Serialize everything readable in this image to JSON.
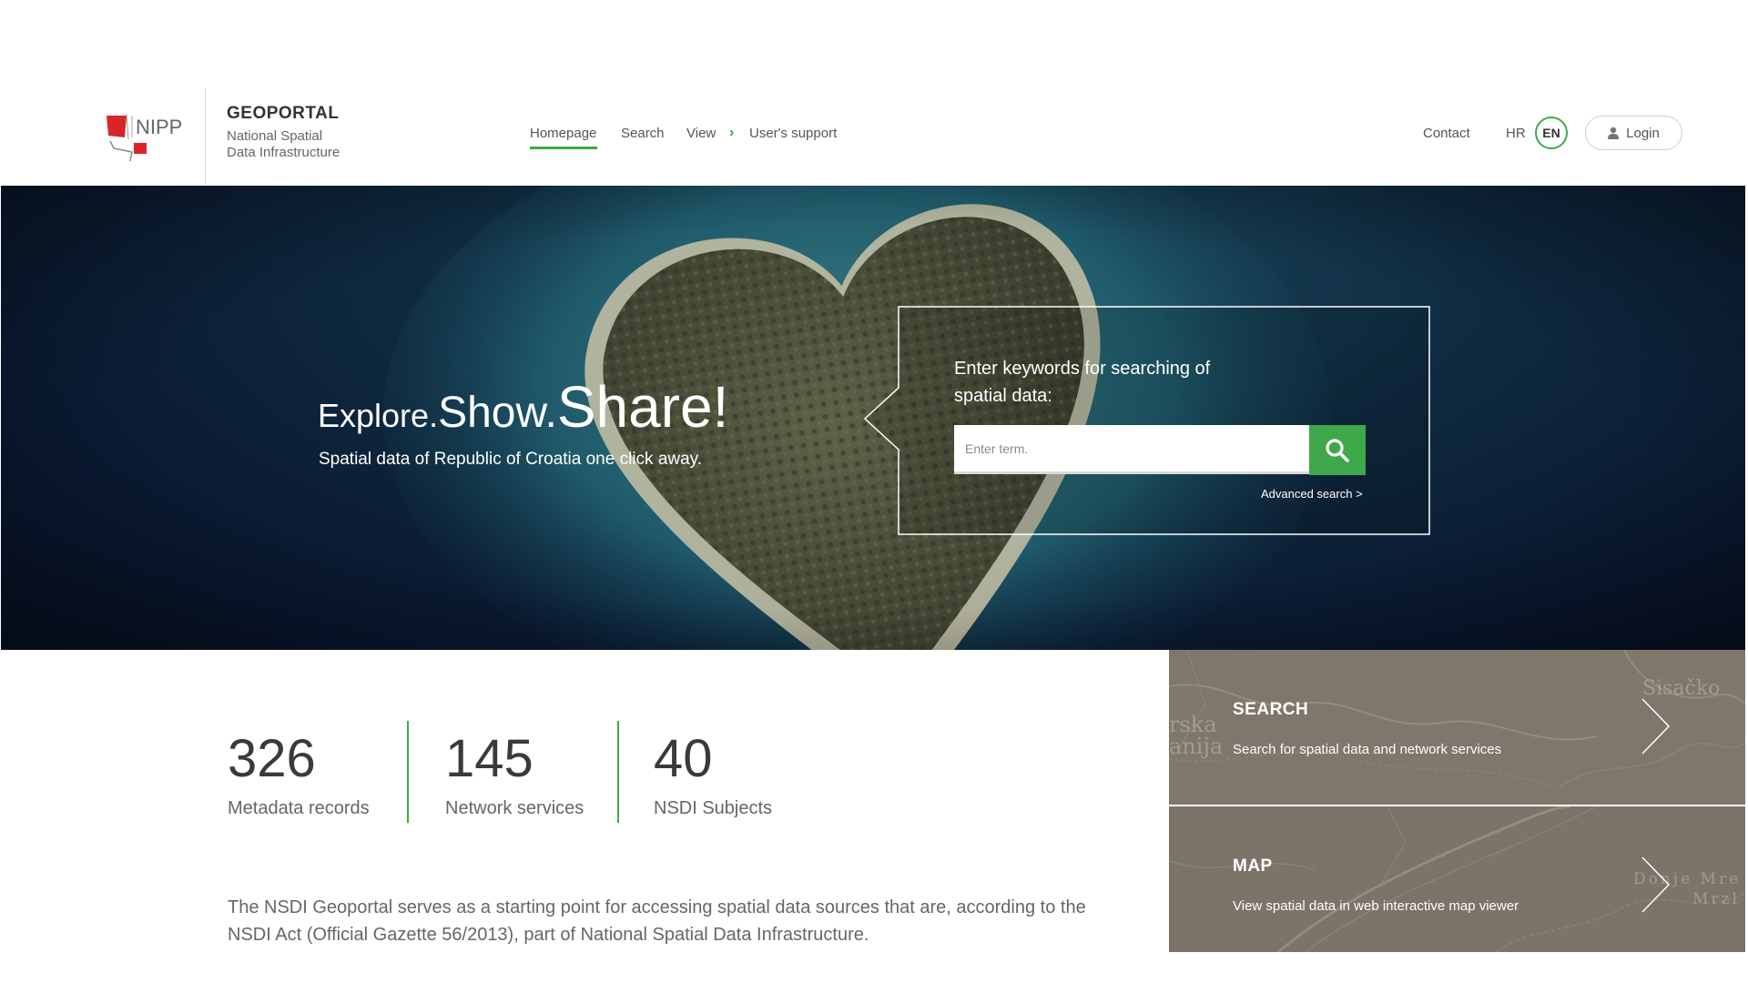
{
  "header": {
    "logo_text": "NIPP",
    "brand_title": "GEOPORTAL",
    "brand_subtitle_line1": "National Spatial",
    "brand_subtitle_line2": "Data Infrastructure",
    "nav": {
      "homepage": "Homepage",
      "search": "Search",
      "view": "View",
      "users_support": "User's support",
      "contact": "Contact"
    },
    "lang_hr": "HR",
    "lang_en": "EN",
    "login_label": "Login",
    "accent_color": "#3fa84a"
  },
  "hero": {
    "tagline_a": "Explore.",
    "tagline_b": "Show.",
    "tagline_c": "Share!",
    "subtitle": "Spatial data of Republic of Croatia one click away.",
    "search_prompt": "Enter keywords for searching of spatial data:",
    "search_placeholder": "Enter term.",
    "advanced_search": "Advanced search >"
  },
  "stats": [
    {
      "value": "326",
      "label": "Metadata records"
    },
    {
      "value": "145",
      "label": "Network services"
    },
    {
      "value": "40",
      "label": "NSDI Subjects"
    }
  ],
  "description": "The NSDI Geoportal serves as a starting point for accessing spatial data sources that are, according to the NSDI Act (Official Gazette 56/2013), part of National Spatial Data Infrastructure.",
  "tiles": {
    "search": {
      "title": "SEARCH",
      "desc": "Search for spatial data and network services"
    },
    "map": {
      "title": "MAP",
      "desc": "View spatial data in web interactive map viewer"
    }
  }
}
